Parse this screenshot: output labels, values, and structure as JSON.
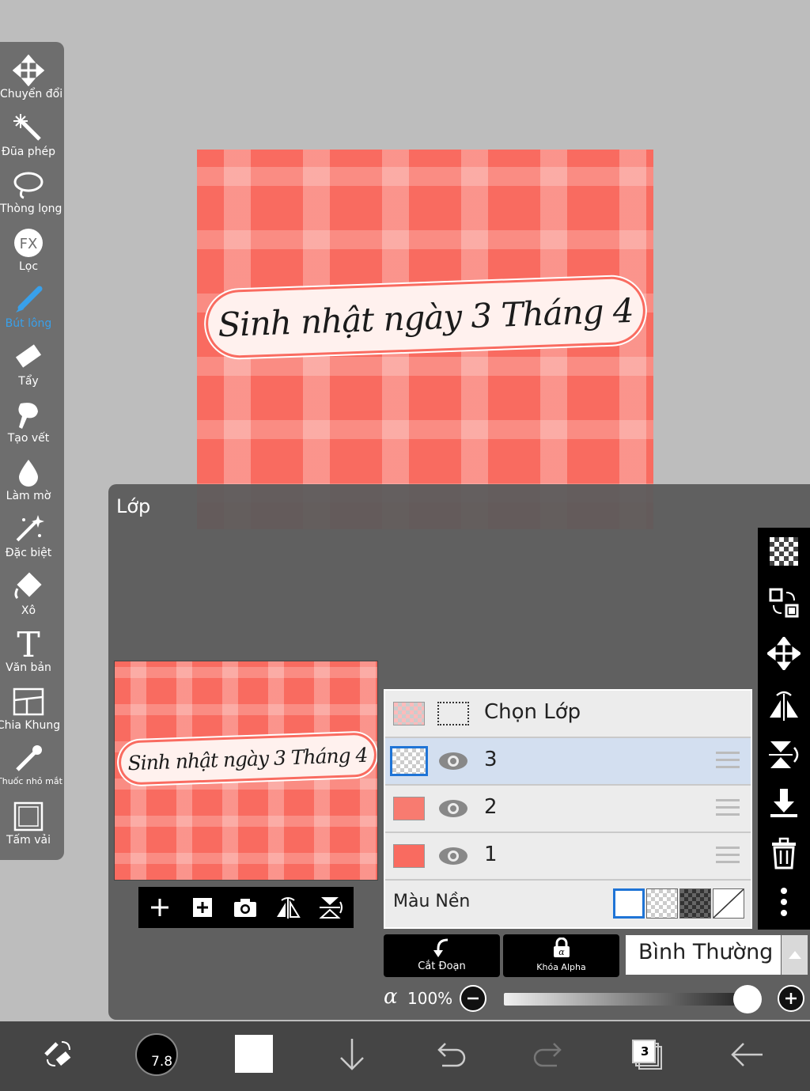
{
  "toolbar": {
    "items": [
      {
        "label": "Chuyển đổi",
        "icon": "move-icon"
      },
      {
        "label": "Đũa phép",
        "icon": "magic-wand-icon"
      },
      {
        "label": "Thòng lọng",
        "icon": "lasso-icon"
      },
      {
        "label": "Lọc",
        "icon": "fx-filter-icon"
      },
      {
        "label": "Bút lông",
        "icon": "brush-icon",
        "active": true
      },
      {
        "label": "Tẩy",
        "icon": "eraser-icon"
      },
      {
        "label": "Tạo vết",
        "icon": "smudge-icon"
      },
      {
        "label": "Làm mờ",
        "icon": "blur-drop-icon"
      },
      {
        "label": "Đặc biệt",
        "icon": "special-effect-icon"
      },
      {
        "label": "Xô",
        "icon": "bucket-icon"
      },
      {
        "label": "Văn bản",
        "icon": "text-icon"
      },
      {
        "label": "Chia Khung",
        "icon": "frame-divider-icon"
      },
      {
        "label": "Thuốc nhỏ mắt",
        "icon": "eyedropper-icon"
      },
      {
        "label": "Tấm vải",
        "icon": "canvas-icon"
      }
    ]
  },
  "canvas": {
    "banner_text": "Sinh nhật ngày 3 Tháng 4",
    "background_color": "#f96b60"
  },
  "layer_panel": {
    "title": "Lớp",
    "select_layer_label": "Chọn Lớp",
    "layers": [
      {
        "name": "3",
        "selected": true
      },
      {
        "name": "2",
        "selected": false
      },
      {
        "name": "1",
        "selected": false
      }
    ],
    "background_label": "Màu Nền",
    "clip_label": "Cắt Đoạn",
    "alpha_lock_label": "Khóa Alpha",
    "blend_mode": "Bình Thường",
    "alpha_symbol": "α",
    "opacity": "100%"
  },
  "bottom_bar": {
    "brush_size": "7.8",
    "layer_count": "3",
    "primary_color": "#ffffff"
  },
  "colors": {
    "accent": "#39a0ea",
    "selected_layer": "#d3dff0",
    "canvas_red": "#f96b60"
  }
}
